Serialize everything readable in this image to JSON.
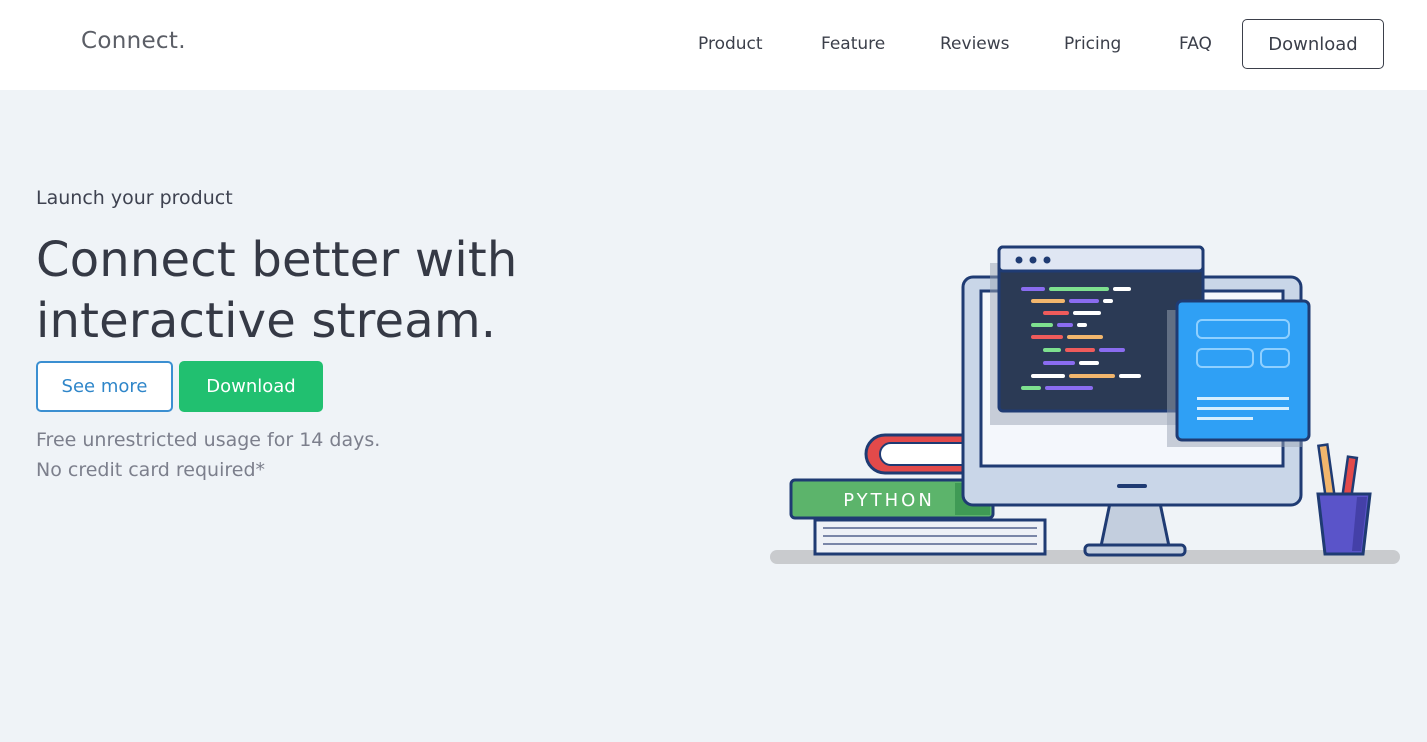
{
  "header": {
    "brand": "Connect.",
    "nav": [
      {
        "label": "Product"
      },
      {
        "label": "Feature"
      },
      {
        "label": "Reviews"
      },
      {
        "label": "Pricing"
      },
      {
        "label": "FAQ"
      }
    ],
    "download_label": "Download"
  },
  "hero": {
    "kicker": "Launch your product",
    "title_line1": "Connect better with",
    "title_line2": "interactive stream.",
    "see_more_label": "See more",
    "download_label": "Download",
    "note_line1": "Free unrestricted usage for 14 days.",
    "note_line2": "No credit card required*"
  },
  "illustration": {
    "book_label": "PYTHON"
  },
  "colors": {
    "accent_green": "#21c070",
    "accent_blue": "#3b8fd1",
    "page_bg": "#eff3f7",
    "text_dark": "#353945"
  }
}
